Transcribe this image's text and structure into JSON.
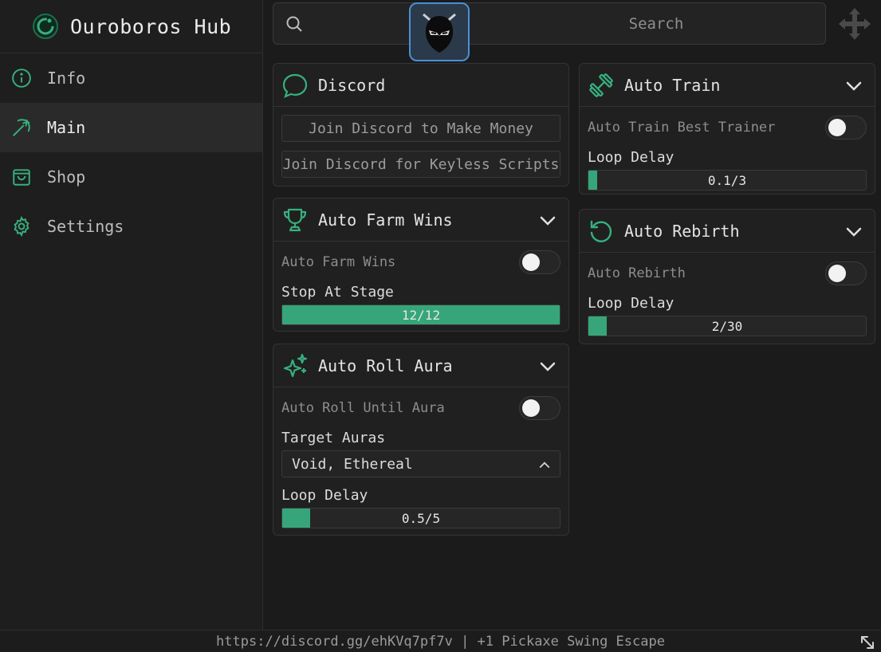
{
  "app": {
    "title": "Ouroboros Hub"
  },
  "sidebar": {
    "items": [
      {
        "label": "Info",
        "icon": "info-icon",
        "active": false
      },
      {
        "label": "Main",
        "icon": "pickaxe-icon",
        "active": true
      },
      {
        "label": "Shop",
        "icon": "shopping-bag-icon",
        "active": false
      },
      {
        "label": "Settings",
        "icon": "gear-icon",
        "active": false
      }
    ]
  },
  "search": {
    "placeholder": "Search"
  },
  "cards": {
    "discord": {
      "title": "Discord",
      "buttons": [
        "Join Discord to Make Money",
        "Join Discord for Keyless Scripts"
      ]
    },
    "auto_farm_wins": {
      "title": "Auto Farm Wins",
      "toggle_label": "Auto Farm Wins",
      "toggle_on": false,
      "slider_label": "Stop At Stage",
      "slider_value": "12/12",
      "slider_fraction": 1.0
    },
    "auto_roll_aura": {
      "title": "Auto Roll Aura",
      "toggle_label": "Auto Roll Until Aura",
      "toggle_on": false,
      "dropdown_label": "Target Auras",
      "dropdown_value": "Void, Ethereal",
      "slider_label": "Loop Delay",
      "slider_value": "0.5/5",
      "slider_fraction": 0.1
    },
    "auto_train": {
      "title": "Auto Train",
      "toggle_label": "Auto Train Best Trainer",
      "toggle_on": false,
      "slider_label": "Loop Delay",
      "slider_value": "0.1/3",
      "slider_fraction": 0.033
    },
    "auto_rebirth": {
      "title": "Auto Rebirth",
      "toggle_label": "Auto Rebirth",
      "toggle_on": false,
      "slider_label": "Loop Delay",
      "slider_value": "2/30",
      "slider_fraction": 0.067
    }
  },
  "footer": {
    "text": "https://discord.gg/ehKVq7pf7v | +1 Pickaxe Swing Escape"
  },
  "colors": {
    "accent": "#36b07f",
    "background": "#1b1b1b",
    "avatar_border": "#4a90d6"
  }
}
